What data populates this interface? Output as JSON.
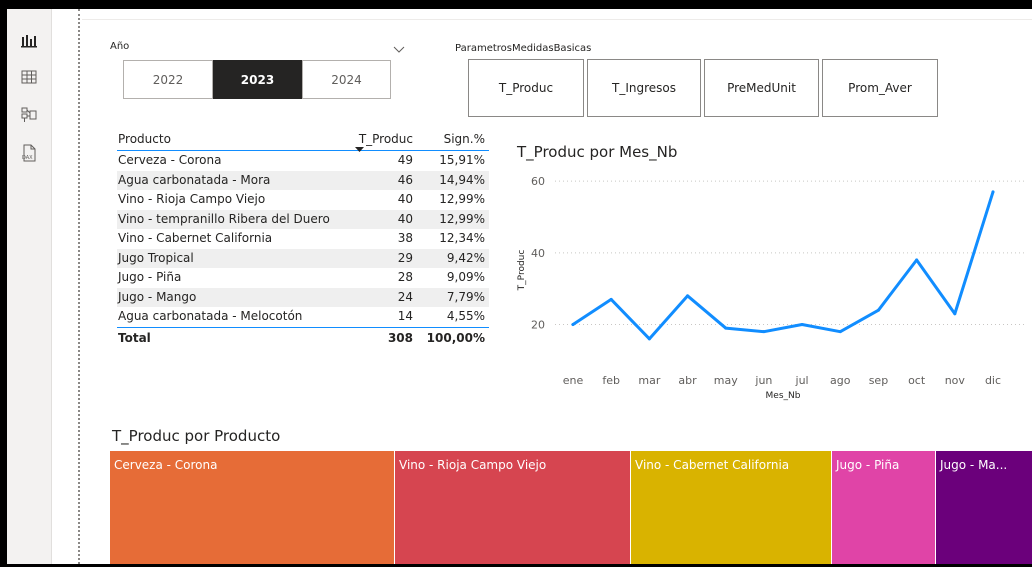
{
  "filters": {
    "year": {
      "label": "Año",
      "options": [
        "2022",
        "2023",
        "2024"
      ],
      "selected": "2023"
    },
    "params": {
      "label": "ParametrosMedidasBasicas",
      "options": [
        "T_Produc",
        "T_Ingresos",
        "PreMedUnit",
        "Prom_Aver"
      ]
    }
  },
  "table": {
    "headers": [
      "Producto",
      "T_Produc",
      "Sign.%"
    ],
    "rows": [
      {
        "producto": "Cerveza - Corona",
        "t_produc": "49",
        "sign": "15,91%"
      },
      {
        "producto": "Agua carbonatada - Mora",
        "t_produc": "46",
        "sign": "14,94%"
      },
      {
        "producto": "Vino - Rioja Campo Viejo",
        "t_produc": "40",
        "sign": "12,99%"
      },
      {
        "producto": "Vino - tempranillo Ribera del Duero",
        "t_produc": "40",
        "sign": "12,99%"
      },
      {
        "producto": "Vino - Cabernet California",
        "t_produc": "38",
        "sign": "12,34%"
      },
      {
        "producto": "Jugo Tropical",
        "t_produc": "29",
        "sign": "9,42%"
      },
      {
        "producto": "Jugo - Piña",
        "t_produc": "28",
        "sign": "9,09%"
      },
      {
        "producto": "Jugo - Mango",
        "t_produc": "24",
        "sign": "7,79%"
      },
      {
        "producto": "Agua carbonatada - Melocotón",
        "t_produc": "14",
        "sign": "4,55%"
      }
    ],
    "total": {
      "label": "Total",
      "t_produc": "308",
      "sign": "100,00%"
    }
  },
  "chart_data": [
    {
      "type": "line",
      "title": "T_Produc por Mes_Nb",
      "xlabel": "Mes_Nb",
      "ylabel": "T_Produc",
      "categories": [
        "ene",
        "feb",
        "mar",
        "abr",
        "may",
        "jun",
        "jul",
        "ago",
        "sep",
        "oct",
        "nov",
        "dic"
      ],
      "series": [
        {
          "values": [
            20,
            27,
            16,
            28,
            19,
            18,
            20,
            18,
            24,
            38,
            23,
            57
          ]
        }
      ],
      "yticks": [
        20,
        40,
        60
      ],
      "ylim": [
        14,
        62
      ],
      "grid": true,
      "color": "#118dff"
    },
    {
      "type": "treemap",
      "title": "T_Produc por Producto",
      "items": [
        {
          "label": "Cerveza - Corona",
          "color": "#e66c37"
        },
        {
          "label": "Vino - Rioja Campo Viejo",
          "color": "#d64550"
        },
        {
          "label": "Vino - Cabernet California",
          "color": "#d9b300"
        },
        {
          "label": "Jugo - Piña",
          "color": "#e044a7"
        },
        {
          "label": "Jugo - Ma...",
          "color": "#6b007b"
        }
      ]
    }
  ]
}
